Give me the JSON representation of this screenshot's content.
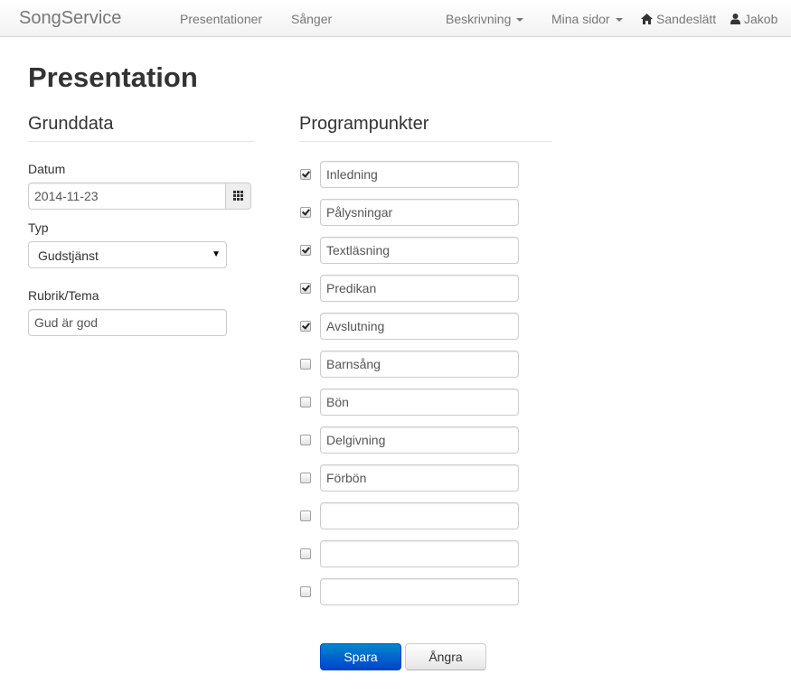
{
  "navbar": {
    "brand": "SongService",
    "links": [
      "Presentationer",
      "Sånger"
    ],
    "dropdowns": [
      "Beskrivning",
      "Mina sidor"
    ],
    "home_label": "Sandeslätt",
    "user_label": "Jakob",
    "home_icon": "home-icon",
    "user_icon": "user-icon"
  },
  "page": {
    "title": "Presentation"
  },
  "grunddata": {
    "heading": "Grunddata",
    "date_label": "Datum",
    "date_value": "2014-11-23",
    "calendar_icon": "calendar-icon",
    "type_label": "Typ",
    "type_value": "Gudstjänst",
    "theme_label": "Rubrik/Tema",
    "theme_value": "Gud är god"
  },
  "programpunkter": {
    "heading": "Programpunkter",
    "items": [
      {
        "label": "Inledning",
        "checked": true
      },
      {
        "label": "Pålysningar",
        "checked": true
      },
      {
        "label": "Textläsning",
        "checked": true
      },
      {
        "label": "Predikan",
        "checked": true
      },
      {
        "label": "Avslutning",
        "checked": true
      },
      {
        "label": "Barnsång",
        "checked": false
      },
      {
        "label": "Bön",
        "checked": false
      },
      {
        "label": "Delgivning",
        "checked": false
      },
      {
        "label": "Förbön",
        "checked": false
      },
      {
        "label": "",
        "checked": false
      },
      {
        "label": "",
        "checked": false
      },
      {
        "label": "",
        "checked": false
      }
    ]
  },
  "actions": {
    "save_label": "Spara",
    "cancel_label": "Ångra"
  },
  "colors": {
    "primary": "#0055cc",
    "navbar_text": "#777777"
  }
}
